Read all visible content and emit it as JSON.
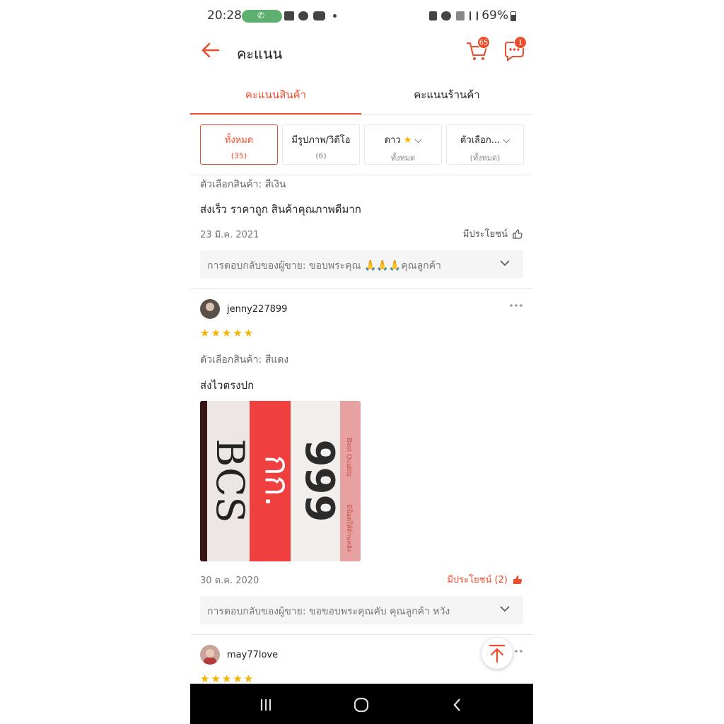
{
  "status_bar": {
    "time": "20:28",
    "battery": "69%"
  },
  "header": {
    "title": "คะแนน",
    "cart_count": "65",
    "chat_count": "1"
  },
  "tabs": [
    {
      "label": "คะแนนสินค้า",
      "active": true
    },
    {
      "label": "คะแนนร้านค้า",
      "active": false
    }
  ],
  "filters": [
    {
      "label": "ทั้งหมด",
      "sub": "(35)",
      "active": true
    },
    {
      "label": "มีรูปภาพ/วิดีโอ",
      "sub": "(6)",
      "active": false
    },
    {
      "label": "ดาว",
      "sub": "ทั้งหมด",
      "active": false
    },
    {
      "label": "ตัวเลือก...",
      "sub": "(ทั้งหมด)",
      "active": false
    }
  ],
  "reviews": [
    {
      "variant": "ตัวเลือกสินค้า: สีเงิน",
      "text": "ส่งเร็ว ราคาถูก สินค้าคุณภาพดีมาก",
      "date": "23 มิ.ค. 2021",
      "helpful": "มีประโยชน์",
      "seller_reply": "การตอบกลับของผู้ขาย: ขอบพระคุณ 🙏🙏🙏คุณลูกค้า"
    },
    {
      "username": "jenny227899",
      "rating": 5,
      "stars": "★★★★★",
      "variant": "ตัวเลือกสินค้า: สีแดง",
      "text": "ส่งไวตรงปก",
      "photo_text": {
        "brand": "BCS",
        "unit": "กก.",
        "number": "999",
        "side": "มีน็อตให้ด้านหลัง",
        "tag": "Best Quality"
      },
      "date": "30 ต.ค. 2020",
      "helpful": "มีประโยชน์ (2)",
      "seller_reply": "การตอบกลับของผู้ขาย: ขอขอบพระคุณคับ คุณลูกค้า หวัง"
    },
    {
      "username": "may77love",
      "rating": 5,
      "stars": "★★★★★"
    }
  ],
  "colors": {
    "accent": "#ee4d2d",
    "star": "#f5b300"
  }
}
